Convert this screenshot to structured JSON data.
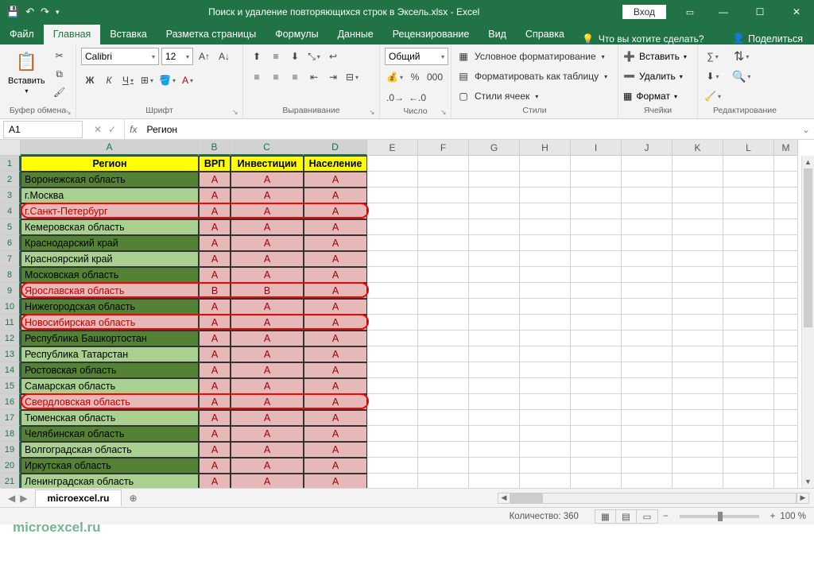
{
  "titlebar": {
    "title": "Поиск и удаление повторяющихся строк в Эксель.xlsx - Excel",
    "login": "Вход"
  },
  "tabs": {
    "file": "Файл",
    "home": "Главная",
    "insert": "Вставка",
    "layout": "Разметка страницы",
    "formulas": "Формулы",
    "data": "Данные",
    "review": "Рецензирование",
    "view": "Вид",
    "help": "Справка",
    "tellme": "Что вы хотите сделать?",
    "share": "Поделиться"
  },
  "ribbon": {
    "clipboard": {
      "label": "Буфер обмена",
      "paste": "Вставить"
    },
    "font": {
      "label": "Шрифт",
      "name": "Calibri",
      "size": "12"
    },
    "alignment": {
      "label": "Выравнивание"
    },
    "number": {
      "label": "Число",
      "format": "Общий"
    },
    "styles": {
      "label": "Стили",
      "cond": "Условное форматирование",
      "table": "Форматировать как таблицу",
      "cell": "Стили ячеек"
    },
    "cells": {
      "label": "Ячейки",
      "insert": "Вставить",
      "delete": "Удалить",
      "format": "Формат"
    },
    "editing": {
      "label": "Редактирование"
    }
  },
  "formulabar": {
    "cellref": "A1",
    "value": "Регион"
  },
  "columns": [
    "A",
    "B",
    "C",
    "D",
    "E",
    "F",
    "G",
    "H",
    "I",
    "J",
    "K",
    "L",
    "M"
  ],
  "headers": {
    "A": "Регион",
    "B": "ВРП",
    "C": "Инвестиции",
    "D": "Население"
  },
  "rows": [
    {
      "n": 2,
      "region": "Воронежская область",
      "b": "A",
      "c": "A",
      "d": "A",
      "shade": "d",
      "hl": false
    },
    {
      "n": 3,
      "region": "г.Москва",
      "b": "A",
      "c": "A",
      "d": "A",
      "shade": "l",
      "hl": false
    },
    {
      "n": 4,
      "region": "г.Санкт-Петербург",
      "b": "A",
      "c": "A",
      "d": "A",
      "shade": "d",
      "hl": true
    },
    {
      "n": 5,
      "region": "Кемеровская область",
      "b": "A",
      "c": "A",
      "d": "A",
      "shade": "l",
      "hl": false
    },
    {
      "n": 6,
      "region": "Краснодарский край",
      "b": "A",
      "c": "A",
      "d": "A",
      "shade": "d",
      "hl": false
    },
    {
      "n": 7,
      "region": "Красноярский край",
      "b": "A",
      "c": "A",
      "d": "A",
      "shade": "l",
      "hl": false
    },
    {
      "n": 8,
      "region": "Московская область",
      "b": "A",
      "c": "A",
      "d": "A",
      "shade": "d",
      "hl": false
    },
    {
      "n": 9,
      "region": "Ярославская область",
      "b": "B",
      "c": "B",
      "d": "A",
      "shade": "l",
      "hl": true
    },
    {
      "n": 10,
      "region": "Нижегородская область",
      "b": "A",
      "c": "A",
      "d": "A",
      "shade": "d",
      "hl": false
    },
    {
      "n": 11,
      "region": "Новосибирская область",
      "b": "A",
      "c": "A",
      "d": "A",
      "shade": "l",
      "hl": true
    },
    {
      "n": 12,
      "region": "Республика Башкортостан",
      "b": "A",
      "c": "A",
      "d": "A",
      "shade": "d",
      "hl": false
    },
    {
      "n": 13,
      "region": "Республика Татарстан",
      "b": "A",
      "c": "A",
      "d": "A",
      "shade": "l",
      "hl": false
    },
    {
      "n": 14,
      "region": "Ростовская область",
      "b": "A",
      "c": "A",
      "d": "A",
      "shade": "d",
      "hl": false
    },
    {
      "n": 15,
      "region": "Самарская область",
      "b": "A",
      "c": "A",
      "d": "A",
      "shade": "l",
      "hl": false
    },
    {
      "n": 16,
      "region": "Свердловская область",
      "b": "A",
      "c": "A",
      "d": "A",
      "shade": "d",
      "hl": true
    },
    {
      "n": 17,
      "region": "Тюменская область",
      "b": "A",
      "c": "A",
      "d": "A",
      "shade": "l",
      "hl": false
    },
    {
      "n": 18,
      "region": "Челябинская область",
      "b": "A",
      "c": "A",
      "d": "A",
      "shade": "d",
      "hl": false
    },
    {
      "n": 19,
      "region": "Волгоградская область",
      "b": "A",
      "c": "A",
      "d": "A",
      "shade": "l",
      "hl": false
    },
    {
      "n": 20,
      "region": "Иркутская область",
      "b": "A",
      "c": "A",
      "d": "A",
      "shade": "d",
      "hl": false
    },
    {
      "n": 21,
      "region": "Ленинградская область",
      "b": "A",
      "c": "A",
      "d": "A",
      "shade": "l",
      "hl": false
    }
  ],
  "sheet": {
    "name": "microexcel.ru"
  },
  "status": {
    "count_label": "Количество:",
    "count": "360",
    "zoom": "100 %"
  },
  "watermark": "microexcel.ru"
}
